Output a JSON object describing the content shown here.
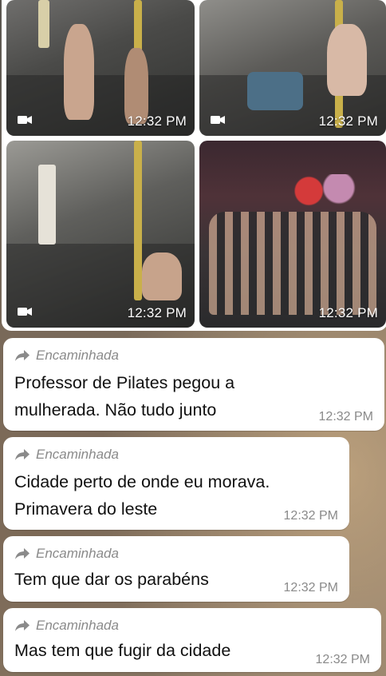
{
  "media_grid": [
    {
      "type": "video",
      "time": "12:32 PM",
      "icon": "video-camera-icon"
    },
    {
      "type": "video",
      "time": "12:32 PM",
      "icon": "video-camera-icon"
    },
    {
      "type": "video",
      "time": "12:32 PM",
      "icon": "video-camera-icon"
    },
    {
      "type": "image",
      "time": "12:32 PM"
    }
  ],
  "messages": [
    {
      "forwarded_label": "Encaminhada",
      "text": "Professor de Pilates pegou a\nmulherada. Não tudo junto",
      "time": "12:32 PM"
    },
    {
      "forwarded_label": "Encaminhada",
      "text": "Cidade perto de onde eu morava.\nPrimavera do leste",
      "time": "12:32 PM"
    },
    {
      "forwarded_label": "Encaminhada",
      "text": "Tem que dar os parabéns",
      "time": "12:32 PM"
    },
    {
      "forwarded_label": "Encaminhada",
      "text": "Mas tem que fugir da cidade",
      "time": "12:32 PM"
    }
  ],
  "colors": {
    "bubble": "#ffffff",
    "meta_text": "#8a8a8a",
    "body_text": "#111111"
  }
}
